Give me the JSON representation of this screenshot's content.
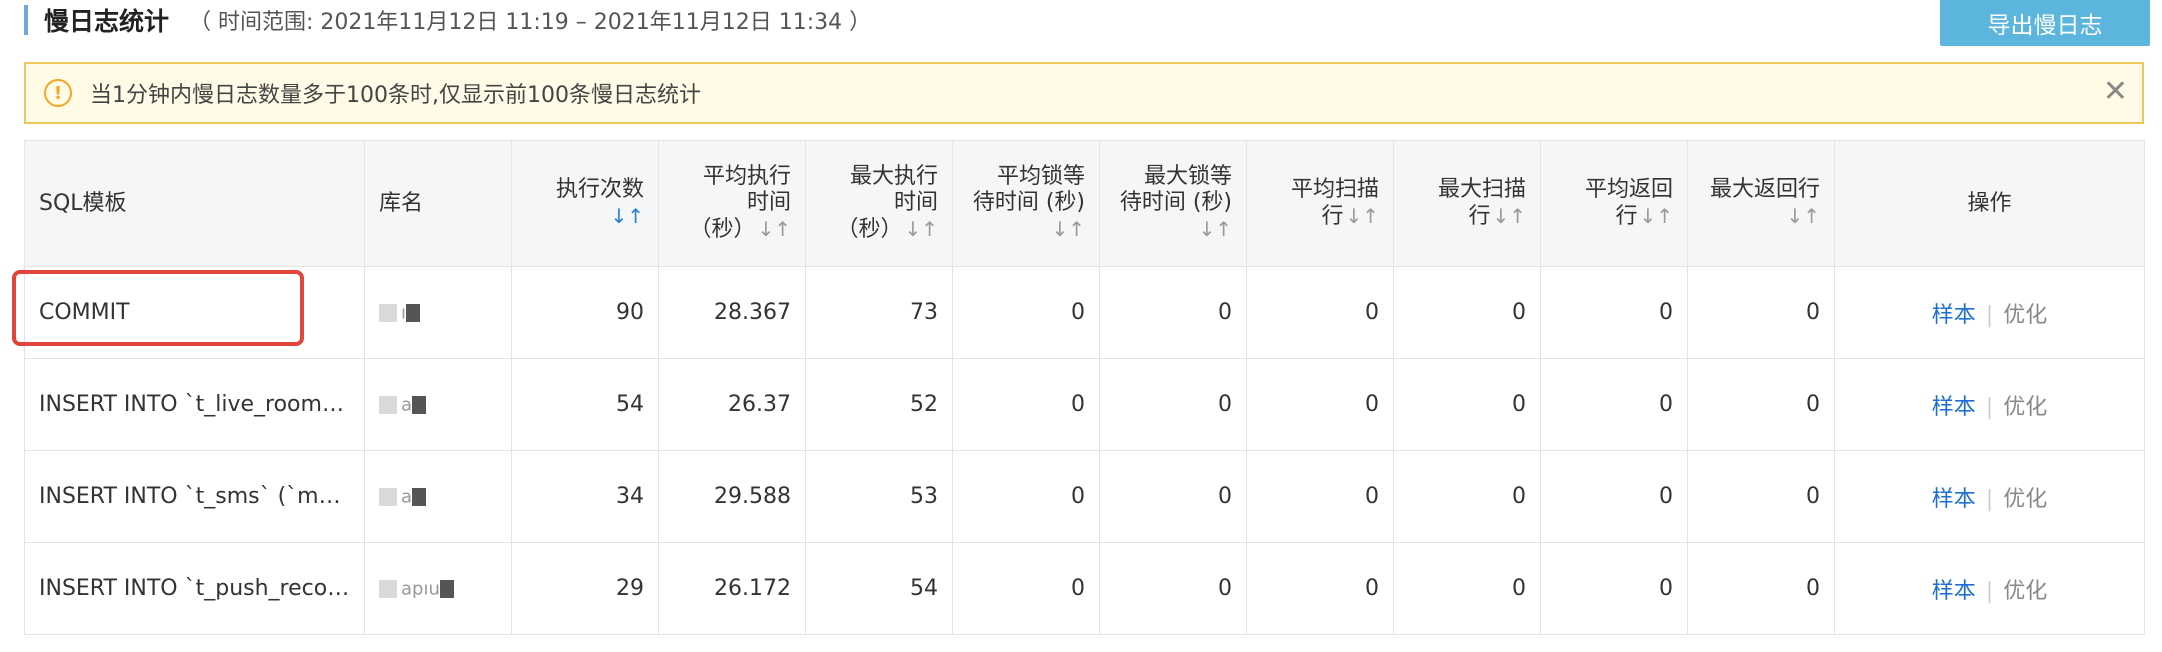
{
  "header": {
    "title": "慢日志统计",
    "range": "（ 时间范围: 2021年11月12日 11:19 – 2021年11月12日 11:34 ）",
    "export_label": "导出慢日志"
  },
  "alert": {
    "icon": "!",
    "text": "当1分钟内慢日志数量多于100条时,仅显示前100条慢日志统计",
    "close": "✕"
  },
  "table": {
    "headers": {
      "sql": "SQL模板",
      "db": "库名",
      "count": "执行次数",
      "avg_exec_1": "平均执行",
      "avg_exec_2": "时间",
      "avg_exec_3": "（秒）",
      "max_exec_1": "最大执行",
      "max_exec_2": "时间",
      "max_exec_3": "（秒）",
      "avg_lock_1": "平均锁等",
      "avg_lock_2": "待时间 (秒)",
      "max_lock_1": "最大锁等",
      "max_lock_2": "待时间 (秒)",
      "avg_scan_1": "平均扫描",
      "avg_scan_2": "行",
      "max_scan_1": "最大扫描",
      "max_scan_2": "行",
      "avg_ret_1": "平均返回",
      "avg_ret_2": "行",
      "max_ret": "最大返回行",
      "actions": "操作"
    },
    "sort_icon": "↓↑",
    "rows": [
      {
        "sql": "COMMIT",
        "db": "ı",
        "count": "90",
        "avg_exec": "28.367",
        "max_exec": "73",
        "avg_lock": "0",
        "max_lock": "0",
        "avg_scan": "0",
        "max_scan": "0",
        "avg_ret": "0",
        "max_ret": "0",
        "sample": "样本",
        "optimize": "优化"
      },
      {
        "sql": "INSERT INTO `t_live_room_…",
        "db": "a",
        "count": "54",
        "avg_exec": "26.37",
        "max_exec": "52",
        "avg_lock": "0",
        "max_lock": "0",
        "avg_scan": "0",
        "max_scan": "0",
        "avg_ret": "0",
        "max_ret": "0",
        "sample": "样本",
        "optimize": "优化"
      },
      {
        "sql": "INSERT INTO `t_sms` (`met…",
        "db": "a",
        "count": "34",
        "avg_exec": "29.588",
        "max_exec": "53",
        "avg_lock": "0",
        "max_lock": "0",
        "avg_scan": "0",
        "max_scan": "0",
        "avg_ret": "0",
        "max_ret": "0",
        "sample": "样本",
        "optimize": "优化"
      },
      {
        "sql": "INSERT INTO `t_push_recor…",
        "db": "apıu",
        "count": "29",
        "avg_exec": "26.172",
        "max_exec": "54",
        "avg_lock": "0",
        "max_lock": "0",
        "avg_scan": "0",
        "max_scan": "0",
        "avg_ret": "0",
        "max_ret": "0",
        "sample": "样本",
        "optimize": "优化"
      }
    ],
    "separator": "|"
  },
  "colors": {
    "accent": "#5bb5dc",
    "link": "#1e6fd0",
    "alert_bg": "#fffbe6",
    "alert_border": "#f0c85a",
    "highlight": "#e0443a"
  }
}
